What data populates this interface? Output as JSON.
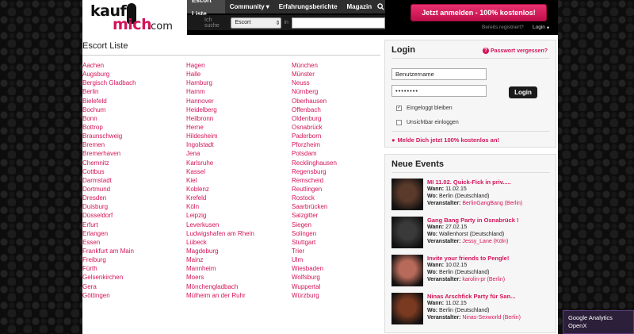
{
  "header": {
    "logo_kauf": "kauf",
    "logo_mich": "mich",
    "logo_com": ".com",
    "nav": [
      {
        "label": "Escort Liste"
      },
      {
        "label": "Community"
      },
      {
        "label": "Erfahrungsberichte"
      },
      {
        "label": "Magazin"
      }
    ],
    "search": {
      "label_prefix": "Ich suche",
      "select_value": "Escort",
      "label_in": "in",
      "input_value": ""
    },
    "signup_label": "Jetzt anmelden - 100% kostenlos!",
    "registered_label": "Bereits registriert?",
    "login_label": "Login"
  },
  "list": {
    "title": "Escort Liste",
    "col1": [
      "Aachen",
      "Augsburg",
      "Bergisch Gladbach",
      "Berlin",
      "Bielefeld",
      "Bochum",
      "Bonn",
      "Bottrop",
      "Braunschweig",
      "Bremen",
      "Bremerhaven",
      "Chemnitz",
      "Cottbus",
      "Darmstadt",
      "Dortmund",
      "Dresden",
      "Duisburg",
      "Düsseldorf",
      "Erfurt",
      "Erlangen",
      "Essen",
      "Frankfurt am Main",
      "Freiburg",
      "Fürth",
      "Gelsenkirchen",
      "Gera",
      "Göttingen"
    ],
    "col2": [
      "Hagen",
      "Halle",
      "Hamburg",
      "Hamm",
      "Hannover",
      "Heidelberg",
      "Heilbronn",
      "Herne",
      "Hildesheim",
      "Ingolstadt",
      "Jena",
      "Karlsruhe",
      "Kassel",
      "Kiel",
      "Koblenz",
      "Krefeld",
      "Köln",
      "Leipzig",
      "Leverkusen",
      "Ludwigshafen am Rhein",
      "Lübeck",
      "Magdeburg",
      "Mainz",
      "Mannheim",
      "Moers",
      "Mönchengladbach",
      "Mülheim an der Ruhr"
    ],
    "col3": [
      "München",
      "Münster",
      "Neuss",
      "Nürnberg",
      "Oberhausen",
      "Offenbach",
      "Oldenburg",
      "Osnabrück",
      "Paderborn",
      "Pforzheim",
      "Potsdam",
      "Recklinghausen",
      "Regensburg",
      "Remscheid",
      "Reutlingen",
      "Rostock",
      "Saarbrücken",
      "Salzgitter",
      "Siegen",
      "Solingen",
      "Stuttgart",
      "Trier",
      "Ulm",
      "Wiesbaden",
      "Wolfsburg",
      "Wuppertal",
      "Würzburg"
    ]
  },
  "login": {
    "title": "Login",
    "forgot": "Passwort vergessen?",
    "username_value": "Benutzername",
    "password_value": "••••••••",
    "button": "Login",
    "remember": "Eingeloggt bleiben",
    "remember_checked": true,
    "invisible": "Unsichtbar einloggen",
    "invisible_checked": false,
    "register_cta": "Melde Dich jetzt 100% kostenlos an!"
  },
  "events": {
    "title": "Neue Events",
    "labels": {
      "when": "Wann:",
      "where": "Wo:",
      "host": "Veranstalter:"
    },
    "items": [
      {
        "title": "MI 11.02. Quick-Fick in priv.....",
        "when": "11.02.15",
        "where": "Berlin (Deutschland)",
        "host": "BerlinGangBang",
        "host_city": "(Berlin)",
        "thumb_color": "#5a3a2a"
      },
      {
        "title": "Gang Bang Party in Osnabrück !",
        "when": "27.02.15",
        "where": "Wallenhorst (Deutschland)",
        "host": "Jessy_Lane",
        "host_city": "(Köln)",
        "thumb_color": "#3a3a3a"
      },
      {
        "title": "Invite your friends to Pengle!",
        "when": "10.02.15",
        "where": "Berlin (Deutschland)",
        "host": "karolin-pr",
        "host_city": "(Berlin)",
        "thumb_color": "#b86a5a"
      },
      {
        "title": "Ninas Arschfick Party für San...",
        "when": "11.02.15",
        "where": "Berlin (Deutschland)",
        "host": "Ninas-Sexworld",
        "host_city": "(Berlin)",
        "thumb_color": "#7a3a22"
      }
    ]
  },
  "badge": {
    "line1": "Google Analytics",
    "line2": "OpenX"
  },
  "colors": {
    "accent": "#d4145a",
    "nav_bg": "#2e2e2e",
    "page_bg": "#0d0d0d"
  }
}
